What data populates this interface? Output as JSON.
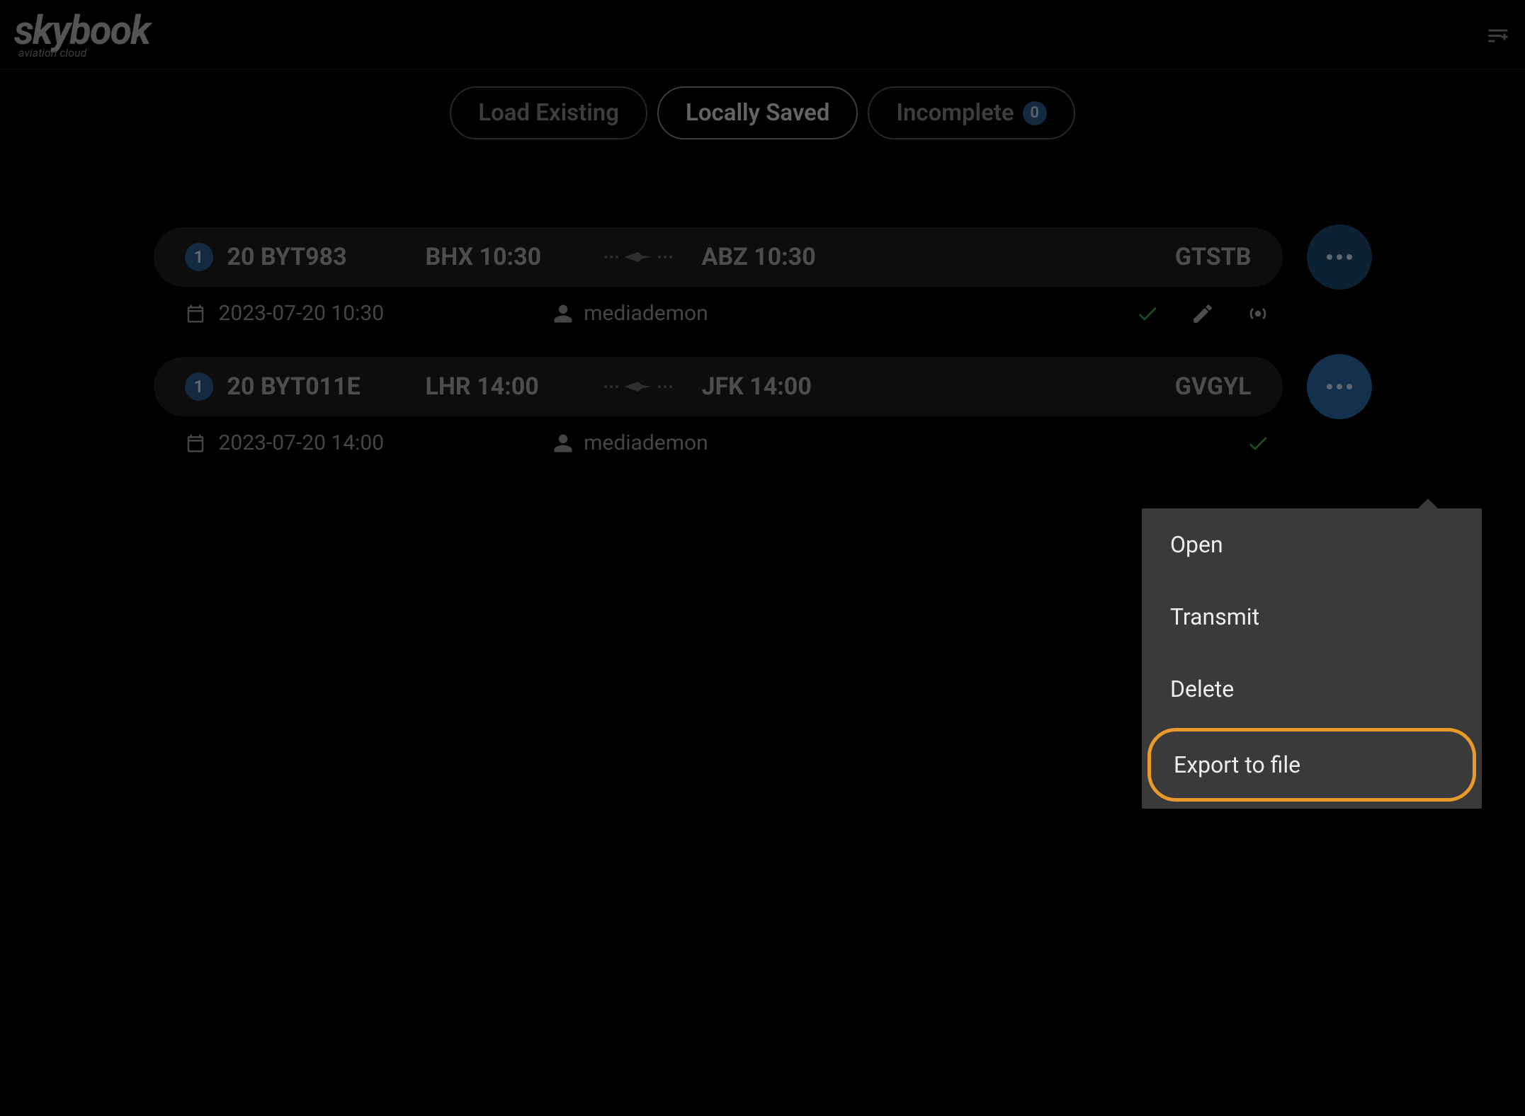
{
  "brand": {
    "name": "skybook",
    "tagline": "aviation cloud"
  },
  "tabs": {
    "load_existing": "Load Existing",
    "locally_saved": "Locally Saved",
    "incomplete": "Incomplete",
    "incomplete_count": "0"
  },
  "flights": [
    {
      "seq": "1",
      "id": "20 BYT983",
      "dep": "BHX 10:30",
      "arr": "ABZ 10:30",
      "tail": "GTSTB",
      "date": "2023-07-20 10:30",
      "user": "mediademon"
    },
    {
      "seq": "1",
      "id": "20 BYT011E",
      "dep": "LHR 14:00",
      "arr": "JFK 14:00",
      "tail": "GVGYL",
      "date": "2023-07-20 14:00",
      "user": "mediademon"
    }
  ],
  "menu": {
    "open": "Open",
    "transmit": "Transmit",
    "delete": "Delete",
    "export": "Export to file"
  }
}
